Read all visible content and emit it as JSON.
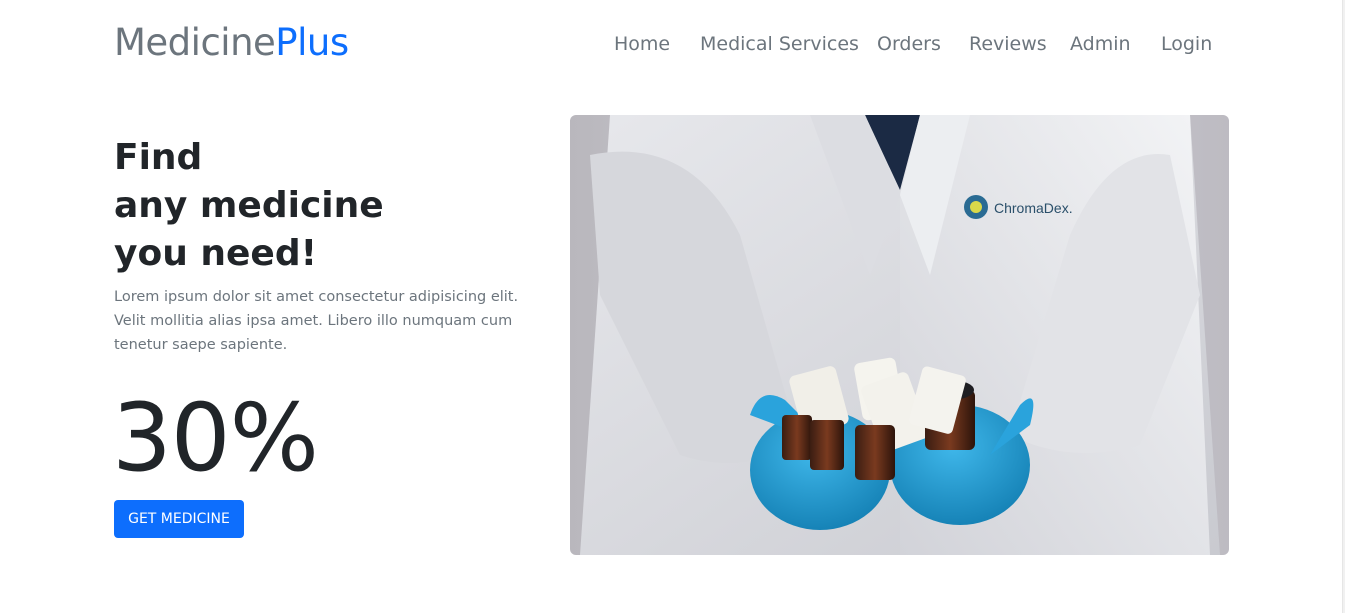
{
  "brand": {
    "part1": "Medicine",
    "part2": "Plus"
  },
  "nav": {
    "items": [
      {
        "label": "Home"
      },
      {
        "label": "Medical Services"
      },
      {
        "label": "Orders"
      },
      {
        "label": "Reviews"
      },
      {
        "label": "Admin"
      },
      {
        "label": "Login"
      }
    ]
  },
  "hero": {
    "title_lines": [
      "Find",
      "any medicine",
      "you need!"
    ],
    "description": "Lorem ipsum dolor sit amet consectetur adipisicing elit. Velit mollitia alias ipsa amet. Libero illo numquam cum tenetur saepe sapiente.",
    "discount": "30%",
    "cta_label": "GET MEDICINE"
  },
  "photo": {
    "coat_logo_text": "ChromaDex."
  },
  "colors": {
    "accent": "#0d6efd",
    "text_dark": "#212529",
    "text_muted": "#6c757d",
    "glove": "#1e9fd6"
  }
}
